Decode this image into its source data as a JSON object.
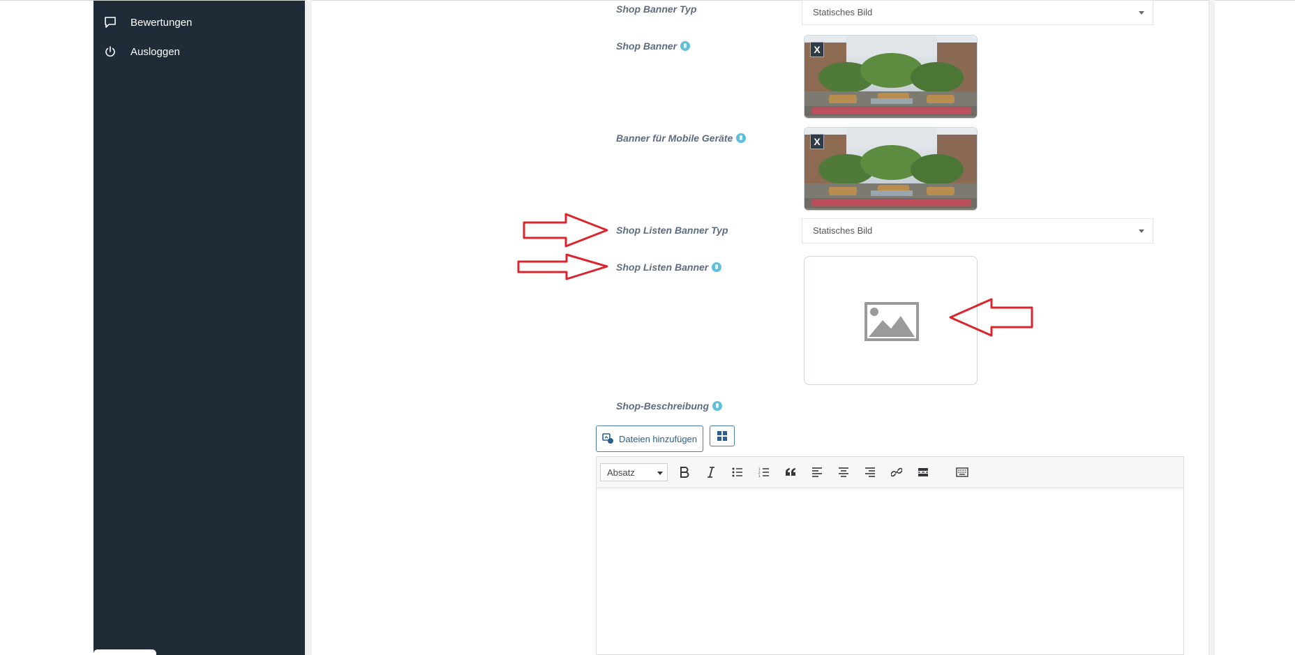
{
  "sidebar": {
    "items": [
      {
        "label": "Bewertungen",
        "icon": "comment-icon"
      },
      {
        "label": "Ausloggen",
        "icon": "power-icon"
      }
    ]
  },
  "form": {
    "shop_banner_type": {
      "label": "Shop Banner Typ",
      "value": "Statisches Bild"
    },
    "shop_banner": {
      "label": "Shop Banner",
      "remove_label": "X"
    },
    "mobile_banner": {
      "label": "Banner für Mobile Geräte",
      "remove_label": "X"
    },
    "list_banner_type": {
      "label": "Shop Listen Banner Typ",
      "value": "Statisches Bild"
    },
    "list_banner": {
      "label": "Shop Listen Banner"
    },
    "description": {
      "label": "Shop-Beschreibung"
    }
  },
  "editor": {
    "add_files_label": "Dateien hinzufügen",
    "format_value": "Absatz",
    "toolbar": [
      "bold",
      "italic",
      "bulleted-list",
      "numbered-list",
      "blockquote",
      "align-left",
      "align-center",
      "align-right",
      "link",
      "read-more",
      "toolbar-toggle"
    ]
  },
  "colors": {
    "sidebar_bg": "#1f2b36",
    "annotation_arrow": "#d9262e",
    "label_text": "#5e6c80",
    "help_icon": "#61c0d9",
    "button_border": "#4d7ea8"
  }
}
